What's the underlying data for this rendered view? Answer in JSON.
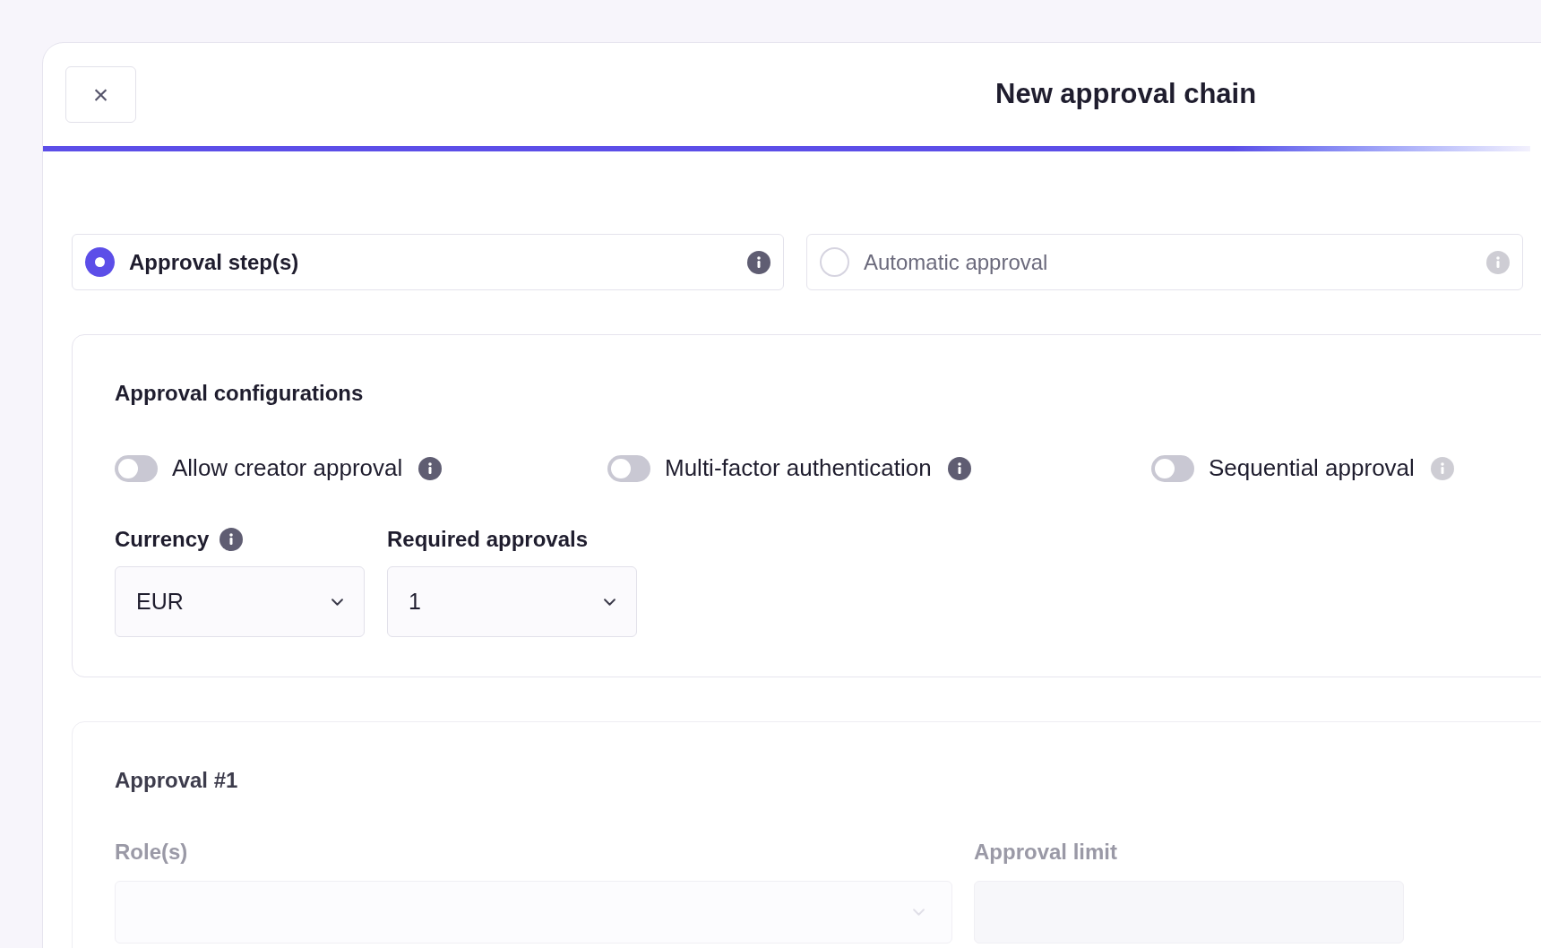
{
  "dialog": {
    "close": "×",
    "title": "New approval chain"
  },
  "approval_types": [
    {
      "label": "Approval step(s)",
      "selected": true,
      "info": true
    },
    {
      "label": "Automatic approval",
      "selected": false,
      "info": true
    }
  ],
  "configurations": {
    "heading": "Approval configurations",
    "toggles": [
      {
        "label": "Allow creator approval",
        "on": false
      },
      {
        "label": "Multi-factor authentication",
        "on": false
      },
      {
        "label": "Sequential approval",
        "on": false
      }
    ],
    "fields": [
      {
        "label": "Currency",
        "info": true,
        "value": "EUR"
      },
      {
        "label": "Required approvals",
        "info": false,
        "value": "1"
      }
    ]
  },
  "approval": {
    "heading": "Approval #1",
    "fields": [
      {
        "label": "Role(s)",
        "kind": "select"
      },
      {
        "label": "Approval limit",
        "kind": "input"
      }
    ]
  }
}
